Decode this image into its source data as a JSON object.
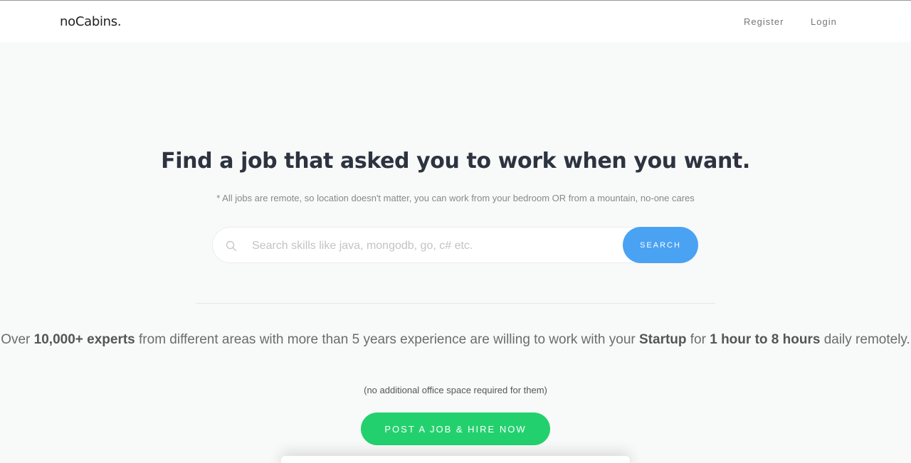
{
  "navbar": {
    "brand": "noCabins.",
    "links": [
      {
        "label": "Register"
      },
      {
        "label": "Login"
      }
    ]
  },
  "hero": {
    "title": "Find a job that asked you to work when you want.",
    "subtitle": "* All jobs are remote, so location doesn't matter, you can work from your bedroom OR from a mountain, no-one cares"
  },
  "search": {
    "placeholder": "Search skills like java, mongodb, go, c# etc.",
    "value": "",
    "button_label": "SEARCH",
    "icon": "search-icon"
  },
  "pitch": {
    "part1": "Over ",
    "experts": "10,000+ experts",
    "part2": " from different areas with more than 5 years experience are willing to work with your ",
    "startup": "Startup",
    "part3": " for ",
    "hours": "1 hour to 8 hours",
    "part4": " daily remotely.",
    "note": "(no additional office space required for them)"
  },
  "cta": {
    "label": "POST A JOB & HIRE NOW"
  },
  "colors": {
    "background": "#f8f9f9",
    "search_button": "#4aa2f3",
    "cta_button": "#22d16d",
    "title": "#2d3440"
  }
}
